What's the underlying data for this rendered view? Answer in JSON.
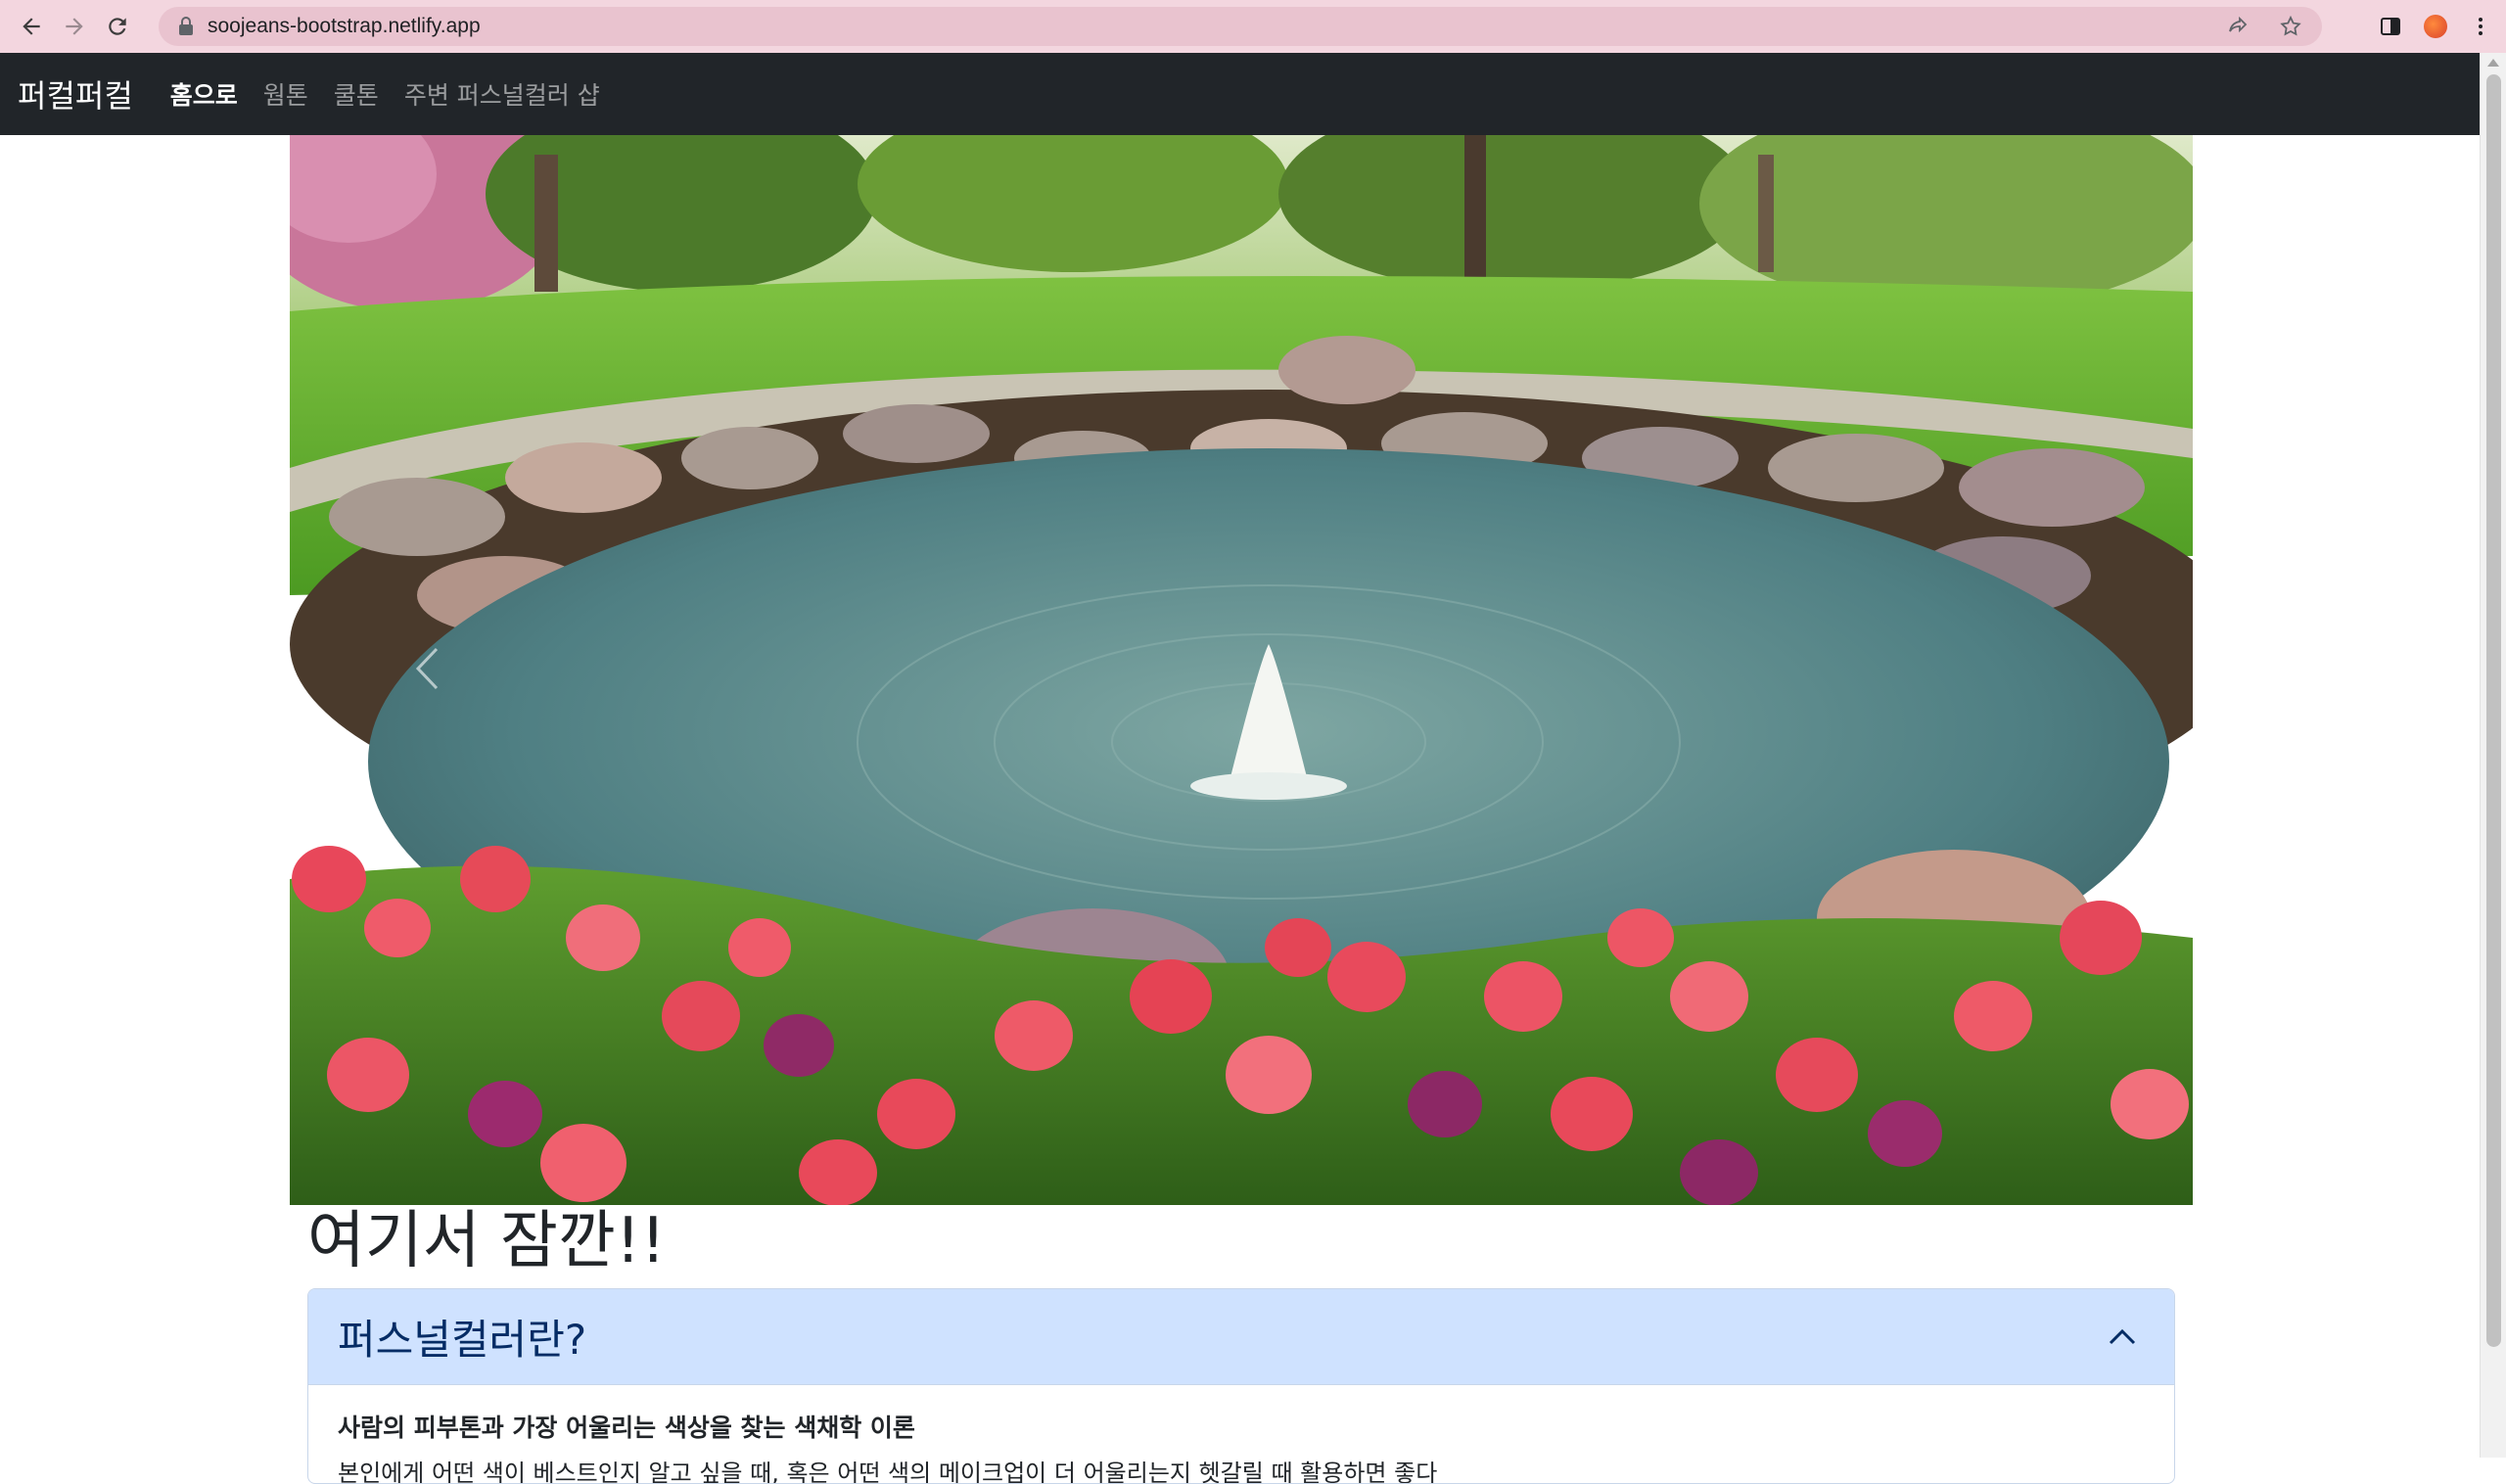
{
  "browser": {
    "url": "soojeans-bootstrap.netlify.app"
  },
  "navbar": {
    "brand": "퍼컬퍼컬",
    "links": [
      {
        "label": "홈으로",
        "active": true
      },
      {
        "label": "웜톤",
        "active": false
      },
      {
        "label": "쿨톤",
        "active": false
      },
      {
        "label": "주변 퍼스널컬러 샵",
        "active": false
      }
    ]
  },
  "carousel": {
    "slide_description_icon": "carousel-prev-icon"
  },
  "main": {
    "headline": "여기서 잠깐!!",
    "accordion": {
      "title": "퍼스널컬러란?",
      "expanded": true,
      "body_bold": "사람의 피부톤과 가장 어울리는 색상을 찾는 색채학 이론",
      "body_text": "본인에게 어떤 색이 베스트인지 알고 싶을 때, 혹은 어떤 색의 메이크업이 더 어울리는지 헷갈릴 때 활용하면 좋다"
    }
  },
  "colors": {
    "browser_bar": "#f3d6df",
    "navbar": "#212529",
    "accordion_header": "#cfe2ff"
  }
}
